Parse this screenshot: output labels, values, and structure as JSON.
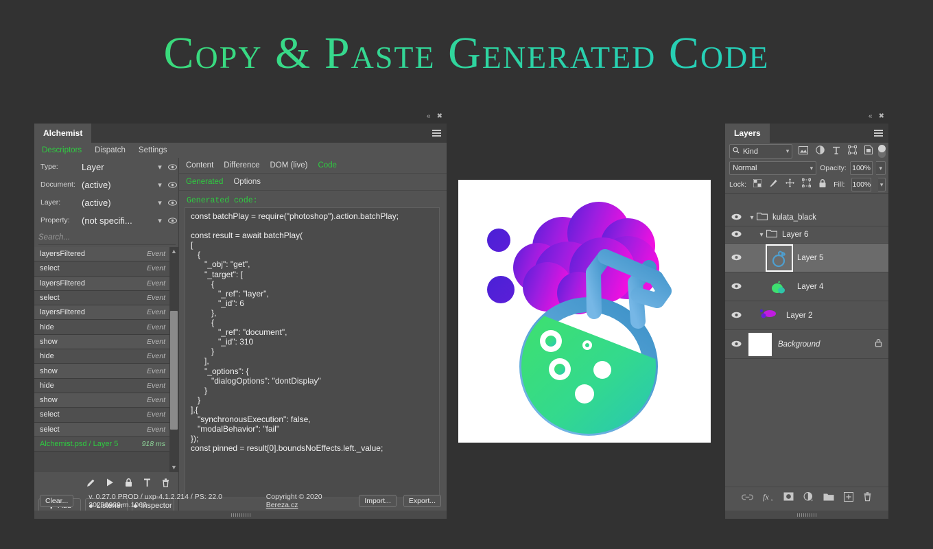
{
  "page": {
    "title": "Copy & Paste Generated Code",
    "background_color": "#323232"
  },
  "alchemist": {
    "window_tab": "Alchemist",
    "topbar": {
      "collapse_icon": "double-chevron-left-icon",
      "close_icon": "close-icon",
      "menu_icon": "hamburger-menu-icon"
    },
    "menu": [
      {
        "label": "Descriptors",
        "active": true
      },
      {
        "label": "Dispatch",
        "active": false
      },
      {
        "label": "Settings",
        "active": false
      }
    ],
    "properties": [
      {
        "label": "Type:",
        "value": "Layer"
      },
      {
        "label": "Document:",
        "value": "(active)"
      },
      {
        "label": "Layer:",
        "value": "(active)"
      },
      {
        "label": "Property:",
        "value": "(not specifi..."
      }
    ],
    "search": {
      "placeholder": "Search..."
    },
    "events": [
      {
        "name": "layersFiltered",
        "type": "Event",
        "selected": false
      },
      {
        "name": "select",
        "type": "Event",
        "selected": false
      },
      {
        "name": "layersFiltered",
        "type": "Event",
        "selected": false
      },
      {
        "name": "select",
        "type": "Event",
        "selected": false
      },
      {
        "name": "layersFiltered",
        "type": "Event",
        "selected": false
      },
      {
        "name": "hide",
        "type": "Event",
        "selected": false
      },
      {
        "name": "show",
        "type": "Event",
        "selected": false
      },
      {
        "name": "hide",
        "type": "Event",
        "selected": false
      },
      {
        "name": "show",
        "type": "Event",
        "selected": false
      },
      {
        "name": "hide",
        "type": "Event",
        "selected": false
      },
      {
        "name": "show",
        "type": "Event",
        "selected": false
      },
      {
        "name": "select",
        "type": "Event",
        "selected": false
      },
      {
        "name": "select",
        "type": "Event",
        "selected": false
      },
      {
        "name": "Alchemist.psd / Layer 5",
        "type": "918 ms",
        "selected": true
      }
    ],
    "tool_icons": [
      "pencil-icon",
      "play-icon",
      "lock-icon",
      "pin-icon",
      "trash-icon"
    ],
    "buttons": [
      {
        "label": "Add",
        "icon": "plus-icon"
      },
      {
        "label": "Listener",
        "icon": "record-dot-icon"
      },
      {
        "label": "Inspector",
        "icon": "record-dot-icon"
      }
    ],
    "code_tabs": [
      {
        "label": "Content",
        "active": false
      },
      {
        "label": "Difference",
        "active": false
      },
      {
        "label": "DOM (live)",
        "active": false
      },
      {
        "label": "Code",
        "active": true
      }
    ],
    "code_subtabs": [
      {
        "label": "Generated",
        "active": true
      },
      {
        "label": "Options",
        "active": false
      }
    ],
    "generated_label": "Generated code:",
    "generated_code": "const batchPlay = require(\"photoshop\").action.batchPlay;\n\nconst result = await batchPlay(\n[\n   {\n      \"_obj\": \"get\",\n      \"_target\": [\n         {\n            \"_ref\": \"layer\",\n            \"_id\": 6\n         },\n         {\n            \"_ref\": \"document\",\n            \"_id\": 310\n         }\n      ],\n      \"_options\": {\n         \"dialogOptions\": \"dontDisplay\"\n      }\n   }\n],{\n   \"synchronousExecution\": false,\n   \"modalBehavior\": \"fail\"\n});\nconst pinned = result[0].boundsNoEffects.left._value;",
    "status": {
      "clear_label": "Clear...",
      "version": "v. 0.27.0 PROD / uxp-4.1.2.214 / PS: 22.0 20200929.m.1062",
      "copyright_prefix": "Copyright © 2020 ",
      "copyright_link": "Bereza.cz",
      "import_label": "Import...",
      "export_label": "Export..."
    }
  },
  "layers_panel": {
    "window_tab": "Layers",
    "topbar": {
      "collapse_icon": "double-chevron-left-icon",
      "close_icon": "close-icon",
      "menu_icon": "hamburger-menu-icon"
    },
    "filter": {
      "kind_label": "Kind",
      "search_icon": "search-icon",
      "icons": [
        "image-filter-icon",
        "adjustment-filter-icon",
        "type-filter-icon",
        "shape-filter-icon",
        "smartobject-filter-icon"
      ],
      "toggle": "filter-enable-toggle"
    },
    "blend": {
      "mode": "Normal",
      "opacity_label": "Opacity:",
      "opacity_value": "100%"
    },
    "lock": {
      "label": "Lock:",
      "icons": [
        "lock-transparent-pixels-icon",
        "lock-image-pixels-icon",
        "lock-position-icon",
        "lock-artboard-icon",
        "lock-all-icon"
      ],
      "fill_label": "Fill:",
      "fill_value": "100%"
    },
    "layers": [
      {
        "name": "kulata_black",
        "kind": "group",
        "visible": true,
        "expanded": true,
        "indent": 0,
        "selected": false,
        "locked": false
      },
      {
        "name": "Layer 6",
        "kind": "group",
        "visible": true,
        "expanded": true,
        "indent": 1,
        "selected": false,
        "locked": false
      },
      {
        "name": "Layer 5",
        "kind": "layer",
        "visible": true,
        "indent": 2,
        "selected": true,
        "locked": false
      },
      {
        "name": "Layer 4",
        "kind": "layer",
        "visible": true,
        "indent": 2,
        "selected": false,
        "locked": false
      },
      {
        "name": "Layer 2",
        "kind": "layer",
        "visible": true,
        "indent": 1,
        "selected": false,
        "locked": false
      },
      {
        "name": "Background",
        "kind": "background",
        "visible": true,
        "indent": 0,
        "selected": false,
        "locked": true
      }
    ],
    "bottom_icons": [
      "link-layers-icon",
      "layer-style-fx-icon",
      "layer-mask-icon",
      "adjustment-layer-icon",
      "new-group-icon",
      "new-layer-icon",
      "delete-layer-icon"
    ]
  },
  "center_image": {
    "name": "alchemist-logo",
    "background": "#ffffff",
    "colors": {
      "flask_outline_top": "#4e9fd0",
      "flask_outline_bottom": "#6fb3e0",
      "liquid_start": "#3ee07a",
      "liquid_end": "#2ec4a8",
      "bubble_purple": "#4b22d4",
      "bubble_magenta": "#e81ce0"
    }
  }
}
